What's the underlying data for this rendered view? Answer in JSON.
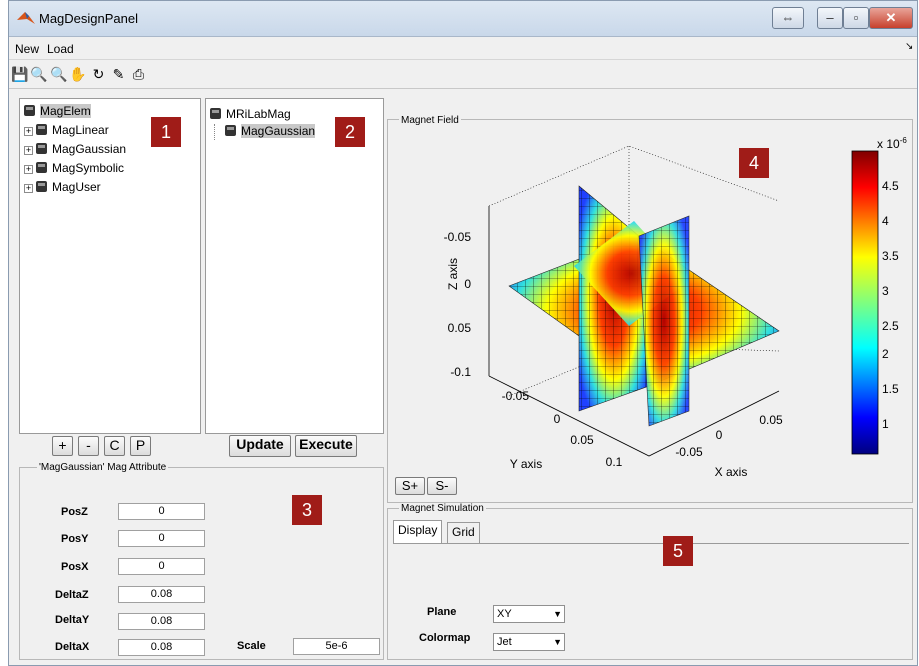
{
  "window": {
    "title": "MagDesignPanel"
  },
  "menu": {
    "new": "New",
    "load": "Load"
  },
  "tree1": {
    "root": "MagElem",
    "items": [
      "MagLinear",
      "MagGaussian",
      "MagSymbolic",
      "MagUser"
    ]
  },
  "tree2": {
    "root": "MRiLabMag",
    "child": "MagGaussian"
  },
  "badges": {
    "b1": "1",
    "b2": "2",
    "b3": "3",
    "b4": "4",
    "b5": "5"
  },
  "buttons": {
    "plus": "+",
    "minus": "-",
    "c": "C",
    "p": "P",
    "update": "Update",
    "execute": "Execute",
    "s_plus": "S+",
    "s_minus": "S-"
  },
  "attr": {
    "title": "'MagGaussian' Mag Attribute",
    "rows": [
      {
        "label": "PosZ",
        "value": "0"
      },
      {
        "label": "PosY",
        "value": "0"
      },
      {
        "label": "PosX",
        "value": "0"
      },
      {
        "label": "DeltaZ",
        "value": "0.08"
      },
      {
        "label": "DeltaY",
        "value": "0.08"
      },
      {
        "label": "DeltaX",
        "value": "0.08"
      }
    ],
    "scale_label": "Scale",
    "scale_value": "5e-6"
  },
  "field_panel": {
    "title": "Magnet Field",
    "z_axis": "Z axis",
    "y_axis": "Y axis",
    "x_axis": "X axis",
    "z_ticks": [
      "-0.05",
      "0",
      "0.05",
      "-0.1"
    ],
    "y_ticks": [
      "-0.05",
      "0",
      "0.05",
      "0.1"
    ],
    "x_ticks": [
      "-0.05",
      "0",
      "0.05"
    ],
    "colorbar_exp": "x 10",
    "colorbar_exp_sup": "-6",
    "colorbar_ticks": [
      "4.5",
      "4",
      "3.5",
      "3",
      "2.5",
      "2",
      "1.5",
      "1"
    ]
  },
  "sim": {
    "title": "Magnet Simulation",
    "tabs": [
      "Display",
      "Grid"
    ],
    "plane_label": "Plane",
    "plane_value": "XY",
    "colormap_label": "Colormap",
    "colormap_value": "Jet"
  },
  "colors": {
    "badge": "#a01c18",
    "accent": "#c7402c"
  },
  "icons": [
    "save-icon",
    "zoom-in-icon",
    "zoom-out-icon",
    "pan-icon",
    "rotate-icon",
    "datacursor-icon",
    "print-icon"
  ]
}
